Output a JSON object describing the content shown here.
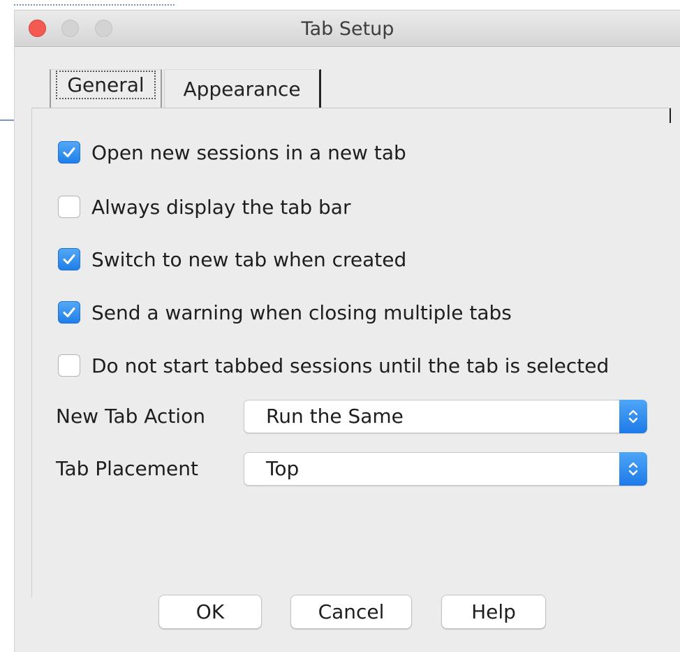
{
  "window": {
    "title": "Tab Setup"
  },
  "tabs": [
    {
      "label": "General",
      "selected": true
    },
    {
      "label": "Appearance",
      "selected": false
    }
  ],
  "options": [
    {
      "label": "Open new sessions in a new tab",
      "checked": true
    },
    {
      "label": "Always display the tab bar",
      "checked": false
    },
    {
      "label": "Switch to new tab when created",
      "checked": true
    },
    {
      "label": "Send a warning when closing multiple tabs",
      "checked": true
    },
    {
      "label": "Do not start tabbed sessions until the tab is selected",
      "checked": false
    }
  ],
  "fields": {
    "new_tab_action": {
      "label": "New Tab Action",
      "value": "Run the Same"
    },
    "tab_placement": {
      "label": "Tab Placement",
      "value": "Top"
    }
  },
  "buttons": {
    "ok": "OK",
    "cancel": "Cancel",
    "help": "Help"
  },
  "colors": {
    "accent": "#1f7ee9",
    "close_button": "#f25a52",
    "window_background": "#ececec"
  }
}
